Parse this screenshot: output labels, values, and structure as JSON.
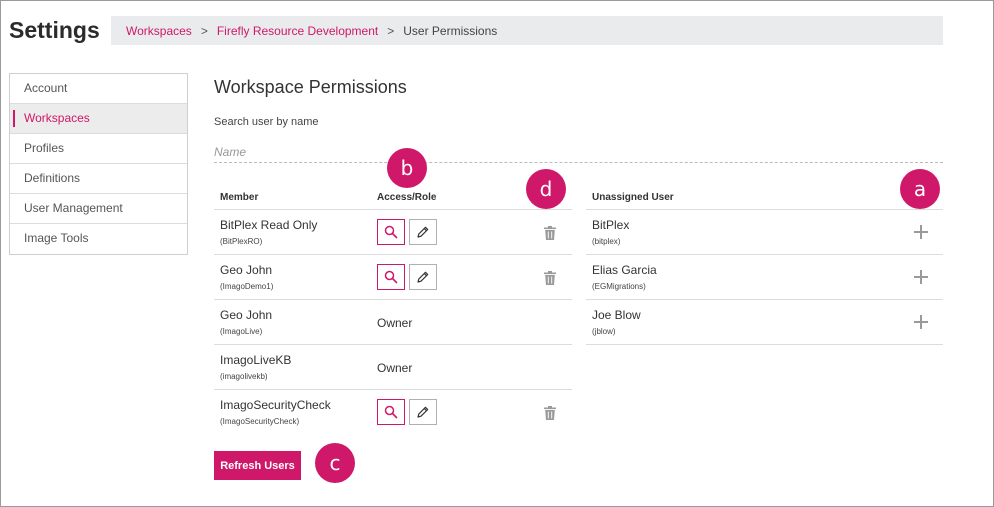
{
  "header": {
    "title": "Settings",
    "breadcrumb": [
      {
        "label": "Workspaces",
        "link": true
      },
      {
        "label": "Firefly Resource Development",
        "link": true
      },
      {
        "label": "User Permissions",
        "link": false
      }
    ],
    "separator": ">"
  },
  "sidebar": {
    "items": [
      {
        "label": "Account",
        "active": false
      },
      {
        "label": "Workspaces",
        "active": true
      },
      {
        "label": "Profiles",
        "active": false
      },
      {
        "label": "Definitions",
        "active": false
      },
      {
        "label": "User Management",
        "active": false
      },
      {
        "label": "Image Tools",
        "active": false
      }
    ]
  },
  "main": {
    "title": "Workspace Permissions",
    "search": {
      "label": "Search user by name",
      "placeholder": "Name",
      "value": ""
    },
    "members": {
      "columns": {
        "member": "Member",
        "access": "Access/Role"
      },
      "rows": [
        {
          "name": "BitPlex Read Only",
          "login": "(BitPlexRO)",
          "role": "",
          "has_actions": true
        },
        {
          "name": "Geo John",
          "login": "(ImagoDemo1)",
          "role": "",
          "has_actions": true
        },
        {
          "name": "Geo John",
          "login": "(ImagoLive)",
          "role": "Owner",
          "has_actions": false
        },
        {
          "name": "ImagoLiveKB",
          "login": "(imagolivekb)",
          "role": "Owner",
          "has_actions": false
        },
        {
          "name": "ImagoSecurityCheck",
          "login": "(ImagoSecurityCheck)",
          "role": "",
          "has_actions": true
        }
      ]
    },
    "unassigned": {
      "column": "Unassigned User",
      "rows": [
        {
          "name": "BitPlex",
          "login": "(bitplex)"
        },
        {
          "name": "Elias Garcia",
          "login": "(EGMigrations)"
        },
        {
          "name": "Joe Blow",
          "login": "(jblow)"
        }
      ]
    },
    "refresh_label": "Refresh Users"
  },
  "callouts": {
    "a": "a",
    "b": "b",
    "c": "c",
    "d": "d"
  },
  "colors": {
    "accent": "#d0186a",
    "breadcrumb_bg": "#e9ebed",
    "icon_gray": "#9a9a9a"
  },
  "icons": {
    "view": "search-icon",
    "edit": "pencil-icon",
    "delete": "trash-icon",
    "add": "plus-icon"
  }
}
